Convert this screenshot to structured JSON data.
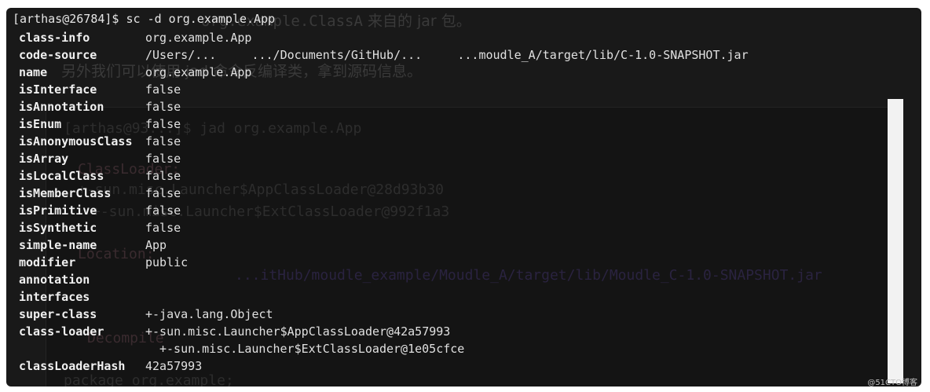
{
  "background": {
    "cn_line1": "来自的 jar 包。",
    "cn_line1_code": "org.example.ClassA",
    "cn_line2": "另外我们可以使用 jad 命令反编译类，拿到源码信息。",
    "ghost_prompt": "[arthas@93...]$ jad org.example.App",
    "ghost_classloader": "ClassLoader:",
    "ghost_loader1": "+-sun.misc.Launcher$AppClassLoader@28d93b30",
    "ghost_loader2": "+-sun.misc.Launcher$ExtClassLoader@992f1a3",
    "ghost_location": "Location:",
    "ghost_path": "...itHub/moudle_example/Moudle_A/target/lib/Moudle_C-1.0-SNAPSHOT.jar",
    "ghost_decompile": "Decompile",
    "ghost_package": "package org.example;",
    "watermark": "@51CTO博客"
  },
  "terminal": {
    "prompt": "[arthas@26784]$ sc -d org.example.App",
    "rows": [
      {
        "key": "class-info",
        "value": "org.example.App"
      },
      {
        "key": "code-source",
        "value": "/Users/...     .../Documents/GitHub/...     ...moudle_A/target/lib/C-1.0-SNAPSHOT.jar"
      },
      {
        "key": "name",
        "value": "org.example.App"
      },
      {
        "key": "isInterface",
        "value": "false"
      },
      {
        "key": "isAnnotation",
        "value": "false"
      },
      {
        "key": "isEnum",
        "value": "false"
      },
      {
        "key": "isAnonymousClass",
        "value": "false"
      },
      {
        "key": "isArray",
        "value": "false"
      },
      {
        "key": "isLocalClass",
        "value": "false"
      },
      {
        "key": "isMemberClass",
        "value": "false"
      },
      {
        "key": "isPrimitive",
        "value": "false"
      },
      {
        "key": "isSynthetic",
        "value": "false"
      },
      {
        "key": "simple-name",
        "value": "App"
      },
      {
        "key": "modifier",
        "value": "public"
      },
      {
        "key": "annotation",
        "value": ""
      },
      {
        "key": "interfaces",
        "value": ""
      },
      {
        "key": "super-class",
        "value": "+-java.lang.Object"
      },
      {
        "key": "class-loader",
        "value": "+-sun.misc.Launcher$AppClassLoader@42a57993"
      },
      {
        "key": "",
        "value": "+-sun.misc.Launcher$ExtClassLoader@1e05cfce",
        "indent": true
      },
      {
        "key": "classLoaderHash",
        "value": "42a57993"
      }
    ]
  }
}
